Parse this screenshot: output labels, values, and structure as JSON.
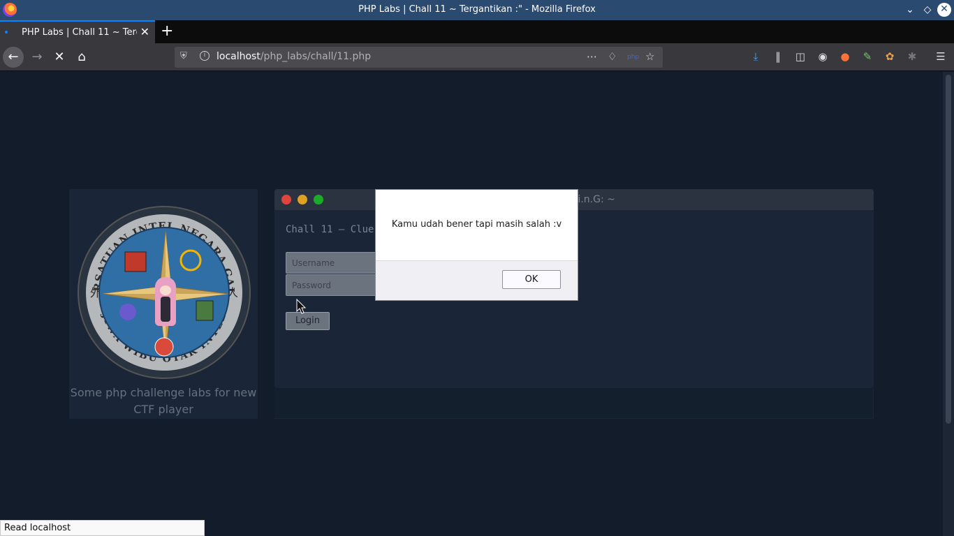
{
  "window": {
    "title": "PHP Labs | Chall 11 ~ Tergantikan :\" - Mozilla Firefox"
  },
  "tab": {
    "label": "PHP Labs | Chall 11 ~ Tergantikan :\""
  },
  "url": {
    "host": "localhost",
    "path": "/php_labs/chall/11.php"
  },
  "sidebar": {
    "seal_text_top": "PERSATUAN INTEL NEGARA GAJIN",
    "seal_text_bottom": "JIWA WIBU OTAK INTEL",
    "seal_char_left": "外",
    "seal_char_right": "人",
    "description": "Some php challenge labs for new CTF player"
  },
  "panel": {
    "title": ".i.n.G: ~",
    "clue": "Chall 11 — Clue",
    "username_placeholder": "Username",
    "password_placeholder": "Password",
    "login_label": "Login",
    "dot_colors": [
      "#e0443e",
      "#dea123",
      "#1aab29"
    ]
  },
  "dialog": {
    "message": "Kamu udah bener tapi masih salah :v",
    "ok_label": "OK"
  },
  "status": {
    "text": "Read localhost"
  }
}
